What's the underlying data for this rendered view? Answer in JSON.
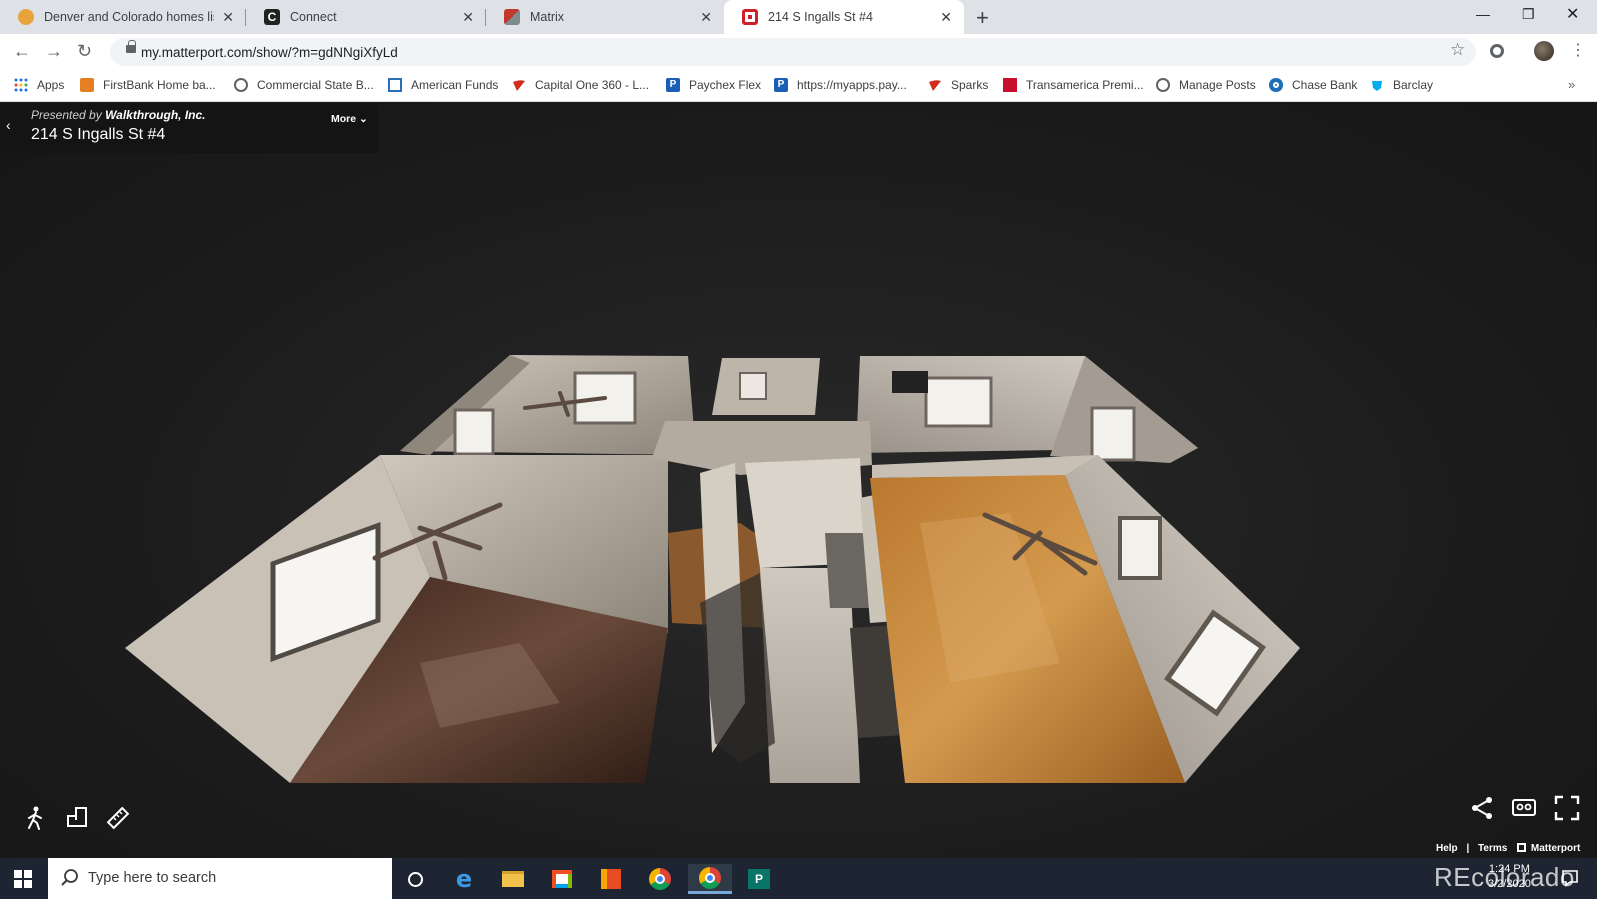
{
  "browser": {
    "tabs": [
      {
        "title": "Denver and Colorado homes listi",
        "favicon": "denver-homes-favicon",
        "color": "#e8a33d",
        "active": false
      },
      {
        "title": "Connect",
        "favicon": "connect-favicon",
        "color": "#222222",
        "active": false
      },
      {
        "title": "Matrix",
        "favicon": "matrix-favicon",
        "color": "#c0392b",
        "active": false
      },
      {
        "title": "214 S Ingalls St #4",
        "favicon": "matterport-favicon",
        "color": "#d0202c",
        "active": true
      }
    ],
    "url": "my.matterport.com/show/?m=gdNNgiXfyLd"
  },
  "bookmarks": [
    {
      "label": "Apps",
      "icon": "apps-grid-icon"
    },
    {
      "label": "FirstBank Home ba...",
      "icon": "firstbank-icon"
    },
    {
      "label": "Commercial State B...",
      "icon": "globe-icon"
    },
    {
      "label": "American Funds",
      "icon": "american-funds-icon"
    },
    {
      "label": "Capital One 360 - L...",
      "icon": "capital-one-icon"
    },
    {
      "label": "Paychex Flex",
      "icon": "paychex-icon"
    },
    {
      "label": "https://myapps.pay...",
      "icon": "paychex-icon"
    },
    {
      "label": "Sparks",
      "icon": "sparks-icon"
    },
    {
      "label": "Transamerica Premi...",
      "icon": "transamerica-icon"
    },
    {
      "label": "Manage Posts",
      "icon": "globe-icon"
    },
    {
      "label": "Chase Bank",
      "icon": "chase-icon"
    },
    {
      "label": "Barclay",
      "icon": "barclay-icon"
    }
  ],
  "viewer": {
    "presented_prefix": "Presented by",
    "presenter": "Walkthrough, Inc.",
    "title": "214 S Ingalls St #4",
    "more_label": "More",
    "footer": {
      "help": "Help",
      "sep": "|",
      "terms": "Terms",
      "brand": "Matterport"
    }
  },
  "taskbar": {
    "search_placeholder": "Type here to search",
    "time": "1:24 PM",
    "date": "3/2/2020"
  },
  "watermark": "REcolorado"
}
